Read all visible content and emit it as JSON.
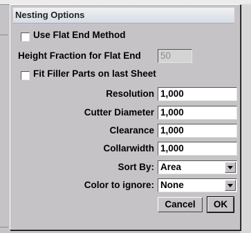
{
  "dialog": {
    "title": "Nesting Options"
  },
  "options": {
    "use_flat_end": {
      "label": "Use Flat End Method",
      "checked": false
    },
    "height_fraction": {
      "label": "Height Fraction for Flat End",
      "value": "50",
      "enabled": false
    },
    "fit_filler": {
      "label": "Fit Filler Parts on last Sheet",
      "checked": false
    }
  },
  "fields": {
    "resolution": {
      "label": "Resolution",
      "value": "1,000"
    },
    "cutter_diameter": {
      "label": "Cutter Diameter",
      "value": "1,000"
    },
    "clearance": {
      "label": "Clearance",
      "value": "1,000"
    },
    "collarwidth": {
      "label": "Collarwidth",
      "value": "1,000"
    }
  },
  "selects": {
    "sort_by": {
      "label": "Sort By:",
      "value": "Area"
    },
    "color_to_ignore": {
      "label": "Color to ignore:",
      "value": "None"
    }
  },
  "buttons": {
    "cancel": "Cancel",
    "ok": "OK"
  }
}
